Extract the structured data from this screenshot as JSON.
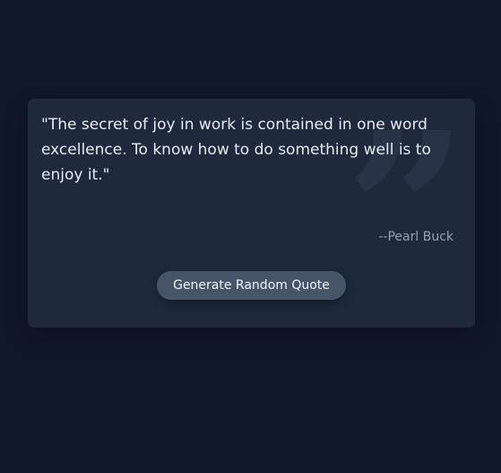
{
  "quote": {
    "text": "\"The secret of joy in work is contained in one word excellence. To know how to do something well is to enjoy it.\"",
    "author": "--Pearl Buck"
  },
  "decor": {
    "quote_glyph": "”",
    "icon": "quote-mark-icon"
  },
  "actions": {
    "generate_label": "Generate Random Quote"
  },
  "colors": {
    "background": "#0f172a",
    "card": "#1e293b",
    "button": "#475569",
    "author_text": "#94a3b8"
  }
}
